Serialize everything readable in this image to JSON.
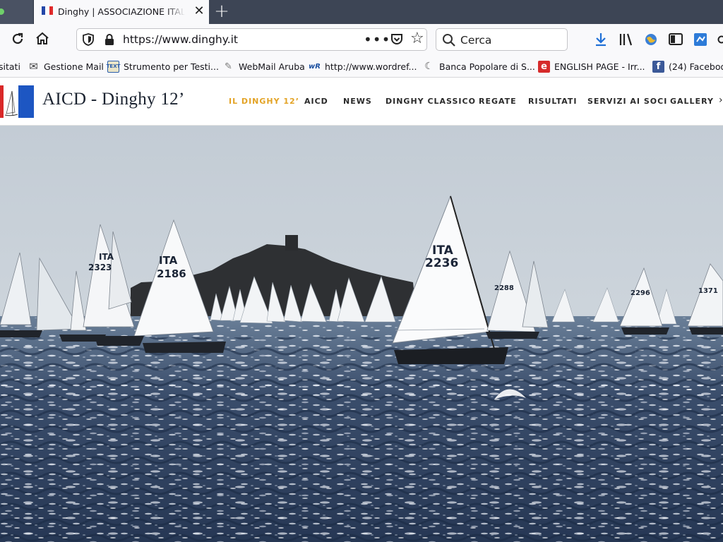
{
  "browser": {
    "tab": {
      "title": "Dinghy | ASSOCIAZIONE ITALIANA"
    },
    "url": "https://www.dinghy.it",
    "search_placeholder": "Cerca"
  },
  "bookmarks": [
    {
      "label": "sitati",
      "icon": "generic-icon"
    },
    {
      "label": "Gestione Mail",
      "icon": "mail-icon",
      "color": "#444444"
    },
    {
      "label": "Strumento per Testi...",
      "icon": "text-tool-icon",
      "color": "#2a5caa"
    },
    {
      "label": "WebMail Aruba",
      "icon": "webmail-icon",
      "color": "#888888"
    },
    {
      "label": "http://www.wordref...",
      "icon": "wordreference-icon",
      "color": "#1a4fa0"
    },
    {
      "label": "Banca Popolare di S...",
      "icon": "bank-icon",
      "color": "#555555"
    },
    {
      "label": "ENGLISH PAGE - Irr...",
      "icon": "englishpage-icon",
      "color": "#d62b2b"
    },
    {
      "label": "(24) Faceboo",
      "icon": "facebook-icon",
      "color": "#3b5998"
    }
  ],
  "site": {
    "title": "AICD - Dinghy 12’",
    "menu": [
      {
        "label": "IL DINGHY 12’",
        "active": true
      },
      {
        "label": "AICD",
        "active": false
      },
      {
        "label": "NEWS",
        "active": false
      },
      {
        "label": "DINGHY CLASSICO",
        "active": false
      },
      {
        "label": "REGATE",
        "active": false
      },
      {
        "label": "RISULTATI",
        "active": false
      },
      {
        "label": "SERVIZI AI SOCI",
        "active": false
      },
      {
        "label": "GALLERY",
        "active": false
      }
    ],
    "accent_color": "#e3a325"
  },
  "hero": {
    "sail_numbers": [
      "2236",
      "2323",
      "2186",
      "2288",
      "2296",
      "1371"
    ],
    "country_code": "ITA"
  }
}
